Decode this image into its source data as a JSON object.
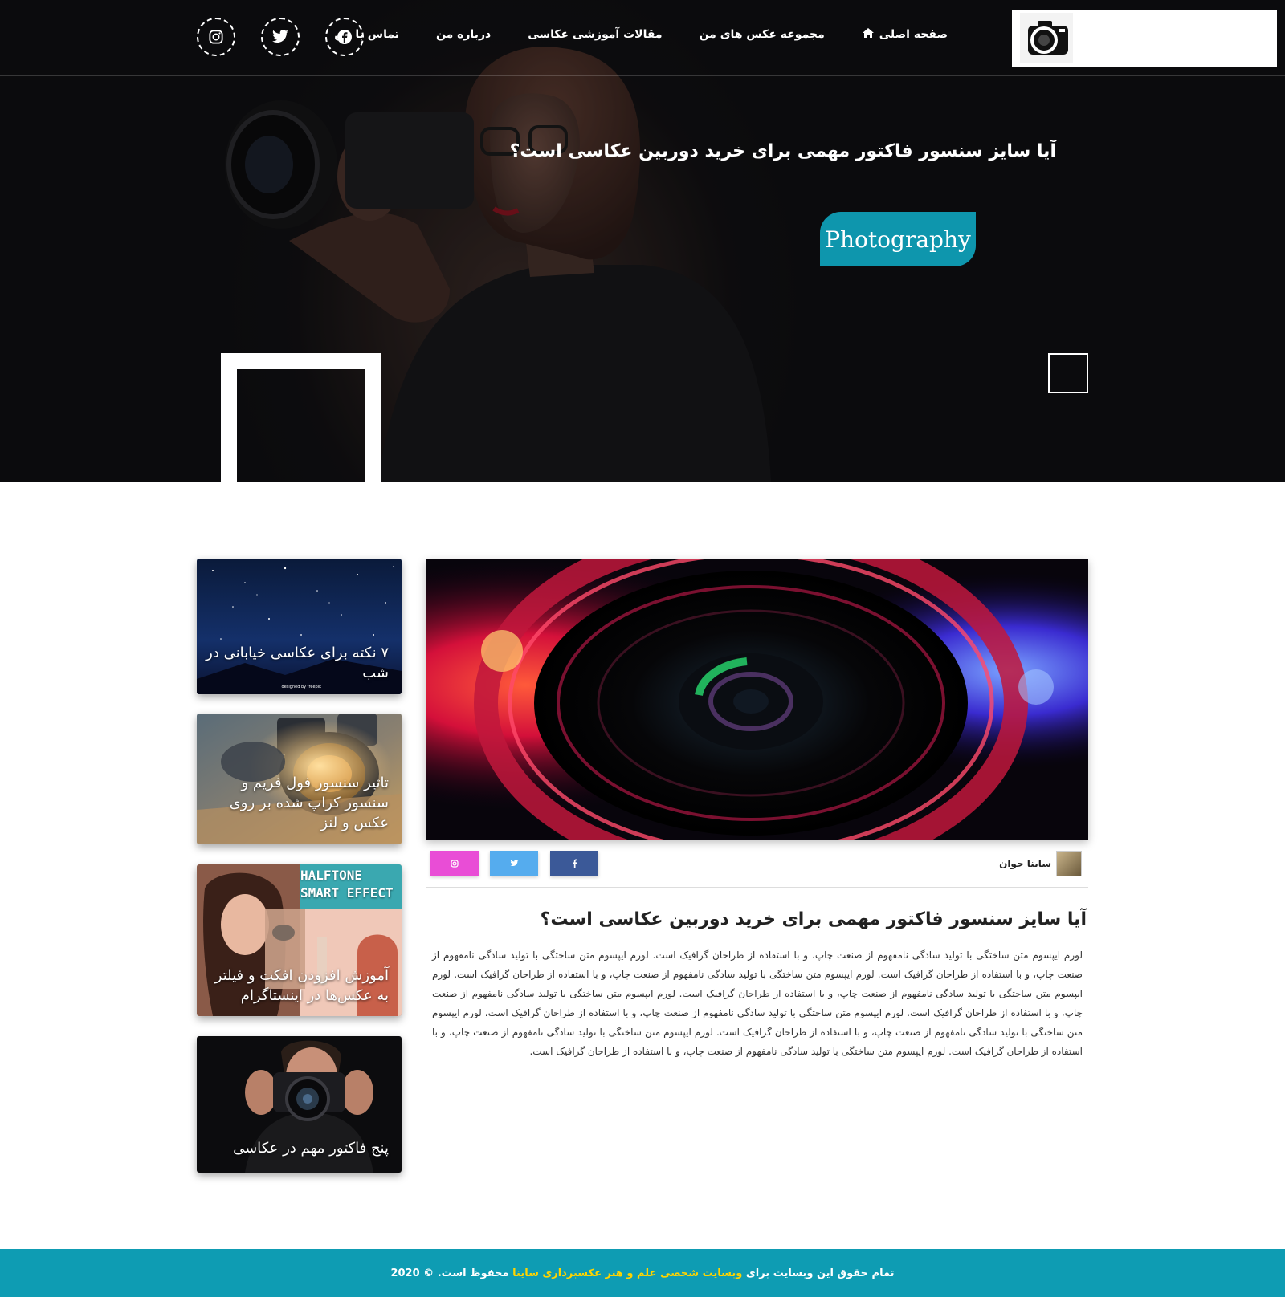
{
  "nav": {
    "items": [
      {
        "label": "صفحه اصلی",
        "icon": "home-icon"
      },
      {
        "label": "مجموعه عکس های من"
      },
      {
        "label": "مقالات آموزشی عکاسی"
      },
      {
        "label": "درباره من"
      },
      {
        "label": "تماس با من"
      }
    ],
    "social": [
      "facebook-icon",
      "twitter-icon",
      "instagram-icon"
    ]
  },
  "hero": {
    "title": "آیا سایز سنسور فاکتور مهمی برای خرید دوربین عکاسی است؟",
    "badge": "Photography"
  },
  "article": {
    "author": "ساینا جوان",
    "share": [
      {
        "icon": "facebook-icon",
        "color": "#3b5998"
      },
      {
        "icon": "twitter-icon",
        "color": "#55acee"
      },
      {
        "icon": "instagram-icon",
        "color": "#e94dd6"
      }
    ],
    "title": "آیا سایز سنسور فاکتور مهمی برای خرید دوربین عکاسی است؟",
    "body": "لورم ایپسوم متن ساختگی با تولید سادگی نامفهوم از صنعت چاپ، و با استفاده از طراحان گرافیک است. لورم ایپسوم متن ساختگی با تولید سادگی نامفهوم از صنعت چاپ، و با استفاده از طراحان گرافیک است. لورم ایپسوم متن ساختگی با تولید سادگی نامفهوم از صنعت چاپ، و با استفاده از طراحان گرافیک است. لورم ایپسوم متن ساختگی با تولید سادگی نامفهوم از صنعت چاپ، و با استفاده از طراحان گرافیک است. لورم ایپسوم متن ساختگی با تولید سادگی نامفهوم از صنعت چاپ، و با استفاده از طراحان گرافیک است. لورم ایپسوم متن ساختگی با تولید سادگی نامفهوم از صنعت چاپ، و با استفاده از طراحان گرافیک است. لورم ایپسوم متن ساختگی با تولید سادگی نامفهوم از صنعت چاپ، و با استفاده از طراحان گرافیک است. لورم ایپسوم متن ساختگی با تولید سادگی نامفهوم از صنعت چاپ، و با استفاده از طراحان گرافیک است. لورم ایپسوم متن ساختگی با تولید سادگی نامفهوم از صنعت چاپ، و با استفاده از طراحان گرافیک است."
  },
  "sidebar": {
    "posts": [
      {
        "title": "۷ نکته برای عکاسی خیابانی در شب",
        "credit": "designed by freepik"
      },
      {
        "title": "تاثیر سنسور فول فریم و سنسور کراپ شده بر روی عکس و لنز"
      },
      {
        "title": "آموزش افزودن افکت و فیلتر به عکس‌ها در اینستاگرام",
        "overlay": "HALFTONE SMART EFFECT"
      },
      {
        "title": "پنج فاکتور مهم در عکاسی"
      }
    ]
  },
  "footer": {
    "prefix": "تمام حقوق این وبسایت برای",
    "highlight": "وبسایت شخصی علم و هنر عکسبرداری ساینا",
    "suffix": "محفوظ است. © 2020"
  }
}
